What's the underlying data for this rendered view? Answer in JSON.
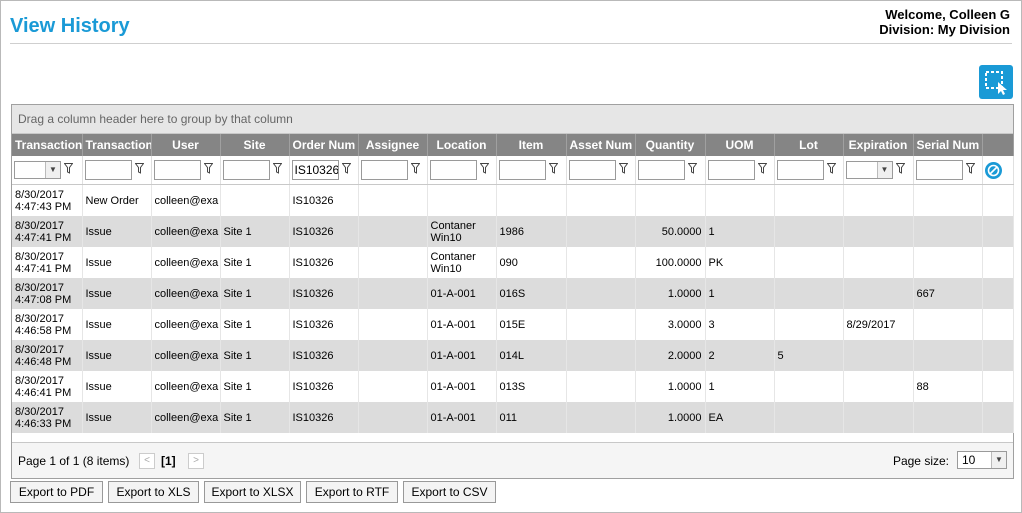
{
  "page": {
    "title": "View History"
  },
  "user": {
    "welcome": "Welcome, Colleen G",
    "division": "Division: My Division"
  },
  "grid": {
    "group_hint": "Drag a column header here to group by that column",
    "columns": [
      "Transaction",
      "Transaction",
      "User",
      "Site",
      "Order Num",
      "Assignee",
      "Location",
      "Item",
      "Asset Num",
      "Quantity",
      "UOM",
      "Lot",
      "Expiration",
      "Serial Num"
    ],
    "filter": {
      "order_num": "IS10326"
    },
    "rows": [
      {
        "date": "8/30/2017",
        "time": "4:47:43 PM",
        "type": "New Order",
        "user": "colleen@exa",
        "site": "",
        "order": "IS10326",
        "assignee": "",
        "loc1": "",
        "loc2": "",
        "item": "",
        "asset": "",
        "qty": "",
        "uom": "",
        "lot": "",
        "exp": "",
        "serial": ""
      },
      {
        "date": "8/30/2017",
        "time": "4:47:41 PM",
        "type": "Issue",
        "user": "colleen@exa",
        "site": "Site 1",
        "order": "IS10326",
        "assignee": "",
        "loc1": "Contaner",
        "loc2": "Win10",
        "item": "1986",
        "asset": "",
        "qty": "50.0000",
        "uom": "1",
        "lot": "",
        "exp": "",
        "serial": ""
      },
      {
        "date": "8/30/2017",
        "time": "4:47:41 PM",
        "type": "Issue",
        "user": "colleen@exa",
        "site": "Site 1",
        "order": "IS10326",
        "assignee": "",
        "loc1": "Contaner",
        "loc2": "Win10",
        "item": "090",
        "asset": "",
        "qty": "100.0000",
        "uom": "PK",
        "lot": "",
        "exp": "",
        "serial": ""
      },
      {
        "date": "8/30/2017",
        "time": "4:47:08 PM",
        "type": "Issue",
        "user": "colleen@exa",
        "site": "Site 1",
        "order": "IS10326",
        "assignee": "",
        "loc1": "01-A-001",
        "loc2": "",
        "item": "016S",
        "asset": "",
        "qty": "1.0000",
        "uom": "1",
        "lot": "",
        "exp": "",
        "serial": "667"
      },
      {
        "date": "8/30/2017",
        "time": "4:46:58 PM",
        "type": "Issue",
        "user": "colleen@exa",
        "site": "Site 1",
        "order": "IS10326",
        "assignee": "",
        "loc1": "01-A-001",
        "loc2": "",
        "item": "015E",
        "asset": "",
        "qty": "3.0000",
        "uom": "3",
        "lot": "",
        "exp": "8/29/2017",
        "serial": ""
      },
      {
        "date": "8/30/2017",
        "time": "4:46:48 PM",
        "type": "Issue",
        "user": "colleen@exa",
        "site": "Site 1",
        "order": "IS10326",
        "assignee": "",
        "loc1": "01-A-001",
        "loc2": "",
        "item": "014L",
        "asset": "",
        "qty": "2.0000",
        "uom": "2",
        "lot": "5",
        "exp": "",
        "serial": ""
      },
      {
        "date": "8/30/2017",
        "time": "4:46:41 PM",
        "type": "Issue",
        "user": "colleen@exa",
        "site": "Site 1",
        "order": "IS10326",
        "assignee": "",
        "loc1": "01-A-001",
        "loc2": "",
        "item": "013S",
        "asset": "",
        "qty": "1.0000",
        "uom": "1",
        "lot": "",
        "exp": "",
        "serial": "88"
      },
      {
        "date": "8/30/2017",
        "time": "4:46:33 PM",
        "type": "Issue",
        "user": "colleen@exa",
        "site": "Site 1",
        "order": "IS10326",
        "assignee": "",
        "loc1": "01-A-001",
        "loc2": "",
        "item": "011",
        "asset": "",
        "qty": "1.0000",
        "uom": "EA",
        "lot": "",
        "exp": "",
        "serial": ""
      }
    ]
  },
  "pager": {
    "info": "Page 1 of 1 (8 items)",
    "prev": "<",
    "current": "[1]",
    "next": ">",
    "page_size_label": "Page size:",
    "page_size": "10"
  },
  "exports": [
    "Export to PDF",
    "Export to XLS",
    "Export to XLSX",
    "Export to RTF",
    "Export to CSV"
  ],
  "colors": {
    "accent": "#1a9ad6",
    "header_bg": "#858585",
    "alt_row": "#dcdcdc"
  },
  "icons": [
    "select-area-icon",
    "filter-funnel-icon",
    "dropdown-arrow-icon",
    "clear-filter-icon"
  ]
}
